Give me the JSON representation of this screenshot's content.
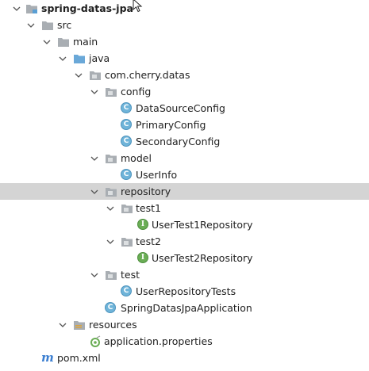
{
  "tree": {
    "root": "spring-datas-jpa",
    "src": "src",
    "main": "main",
    "java": "java",
    "package": "com.cherry.datas",
    "config": "config",
    "config_items": [
      "DataSourceConfig",
      "PrimaryConfig",
      "SecondaryConfig"
    ],
    "model": "model",
    "model_items": [
      "UserInfo"
    ],
    "repository": "repository",
    "test1": "test1",
    "test1_items": [
      "UserTest1Repository"
    ],
    "test2": "test2",
    "test2_items": [
      "UserTest2Repository"
    ],
    "test": "test",
    "test_items": [
      "UserRepositoryTests"
    ],
    "app_class": "SpringDatasJpaApplication",
    "resources": "resources",
    "resources_items": [
      "application.properties"
    ],
    "pom": "pom.xml"
  },
  "icons": {
    "chevron": "chevron-down-icon",
    "folder": "folder-icon",
    "class": "class-icon",
    "interface": "interface-icon",
    "maven": "maven-icon",
    "properties": "properties-file-icon"
  },
  "colors": {
    "selection": "#d4d4d4",
    "folder": "#a9aeb3",
    "source_folder": "#6aa8d8",
    "class_icon": "#6fb4d9",
    "interface_icon": "#6aad55",
    "maven": "#3c7fd1"
  }
}
